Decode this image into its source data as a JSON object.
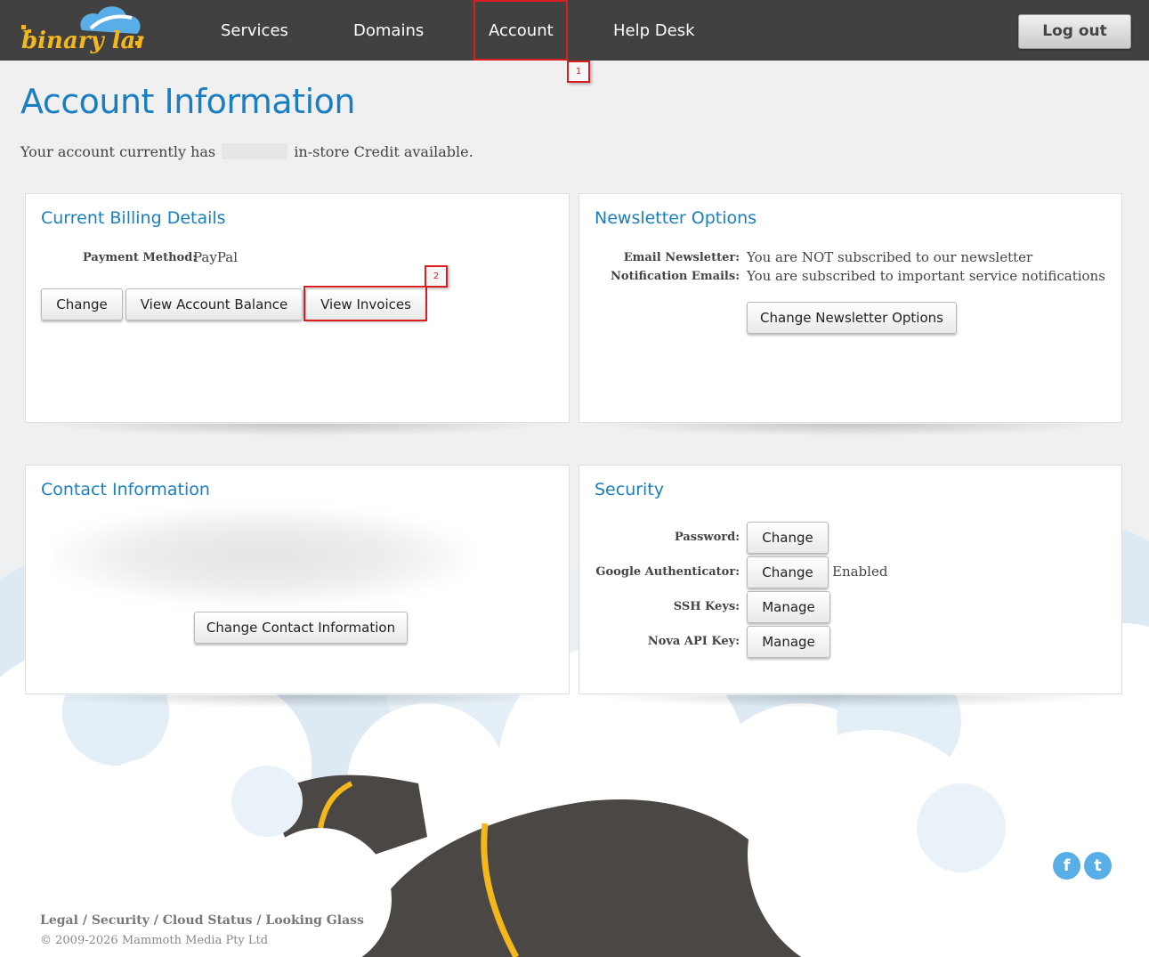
{
  "brand": {
    "logo_text": "binary lane"
  },
  "nav": {
    "services": "Services",
    "domains": "Domains",
    "account": "Account",
    "help_desk": "Help Desk",
    "logout": "Log out"
  },
  "annotations": {
    "marker_1": "1",
    "marker_2": "2",
    "color": "#d81e1e"
  },
  "page": {
    "title": "Account Information",
    "credit_prefix": "Your account currently has",
    "credit_suffix": "in-store Credit available."
  },
  "billing": {
    "title": "Current Billing Details",
    "payment_method_label": "Payment Method:",
    "payment_method_value": "PayPal",
    "change_label": "Change",
    "view_balance_label": "View Account Balance",
    "view_invoices_label": "View Invoices"
  },
  "newsletter": {
    "title": "Newsletter Options",
    "email_label": "Email Newsletter:",
    "email_value": "You are NOT subscribed to our newsletter",
    "notif_label": "Notification Emails:",
    "notif_value": "You are subscribed to important service notifications",
    "change_label": "Change Newsletter Options"
  },
  "contact": {
    "title": "Contact Information",
    "change_label": "Change Contact Information"
  },
  "security": {
    "title": "Security",
    "password_label": "Password:",
    "password_button": "Change",
    "ga_label": "Google Authenticator:",
    "ga_button": "Change",
    "ga_status": "Enabled",
    "ssh_label": "SSH Keys:",
    "ssh_button": "Manage",
    "nova_label": "Nova API Key:",
    "nova_button": "Manage"
  },
  "footer": {
    "links": [
      "Legal",
      "Security",
      "Cloud Status",
      "Looking Glass"
    ],
    "separator": "/",
    "copyright": "© 2009-2026 Mammoth Media Pty Ltd"
  },
  "social": {
    "facebook_glyph": "f",
    "twitter_glyph": "t"
  },
  "colors": {
    "accent": "#1a7fc1",
    "header": "#414141",
    "road": "#4a4744",
    "road_line": "#f5b81c"
  }
}
